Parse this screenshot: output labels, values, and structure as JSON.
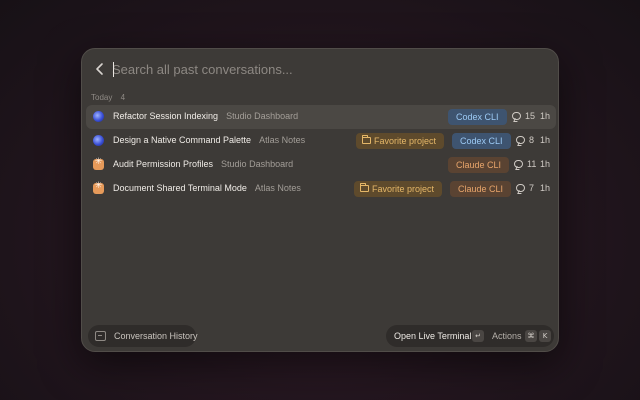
{
  "search": {
    "placeholder": "Search all past conversations...",
    "value": ""
  },
  "section": {
    "label": "Today",
    "count": "4"
  },
  "conversations": [
    {
      "title": "Refactor Session Indexing",
      "project": "Studio Dashboard",
      "tag": "",
      "agent": "Codex CLI",
      "agent_icon": "codex-icon",
      "comments": "15",
      "age": "1h",
      "selected": true
    },
    {
      "title": "Design a Native Command Palette",
      "project": "Atlas Notes",
      "tag": "Favorite project",
      "agent": "Codex CLI",
      "agent_icon": "codex-icon",
      "comments": "8",
      "age": "1h",
      "selected": false
    },
    {
      "title": "Audit Permission Profiles",
      "project": "Studio Dashboard",
      "tag": "",
      "agent": "Claude CLI",
      "agent_icon": "claude-icon",
      "comments": "11",
      "age": "1h",
      "selected": false
    },
    {
      "title": "Document Shared Terminal Mode",
      "project": "Atlas Notes",
      "tag": "Favorite project",
      "agent": "Claude CLI",
      "agent_icon": "claude-icon",
      "comments": "7",
      "age": "1h",
      "selected": false
    }
  ],
  "footer": {
    "history_label": "Conversation History",
    "open_terminal_label": "Open Live Terminal",
    "enter_key": "↵",
    "actions_label": "Actions",
    "cmd_key": "⌘",
    "k_key": "K"
  },
  "colors": {
    "panel": "#3d3a37",
    "codex_badge_bg": "#3e5470",
    "codex_badge_text": "#9ccaf5",
    "claude_badge_bg": "#5a4332",
    "claude_badge_text": "#e8a56b",
    "favorite_badge_bg": "#5e4a2c",
    "favorite_badge_text": "#e5b768"
  }
}
